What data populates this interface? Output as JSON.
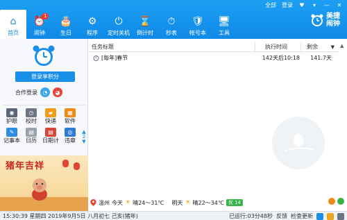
{
  "top_links": {
    "all": "全部",
    "login": "登录",
    "heart": "♥",
    "menu": "▾",
    "minimize": "—",
    "close": "✕"
  },
  "nav": [
    {
      "label": "首页",
      "icon": "home-icon",
      "glyph": "⌂"
    },
    {
      "label": "闹钟",
      "icon": "alarm-clock-icon",
      "glyph": "⏰",
      "badge": "1"
    },
    {
      "label": "生日",
      "icon": "birthday-cake-icon",
      "glyph": "🎂"
    },
    {
      "label": "程序",
      "icon": "gear-icon",
      "glyph": "⚙"
    },
    {
      "label": "定时关机",
      "icon": "power-icon",
      "glyph": "⏻"
    },
    {
      "label": "倒计时",
      "icon": "hourglass-icon",
      "glyph": "⌛"
    },
    {
      "label": "秒表",
      "icon": "stopwatch-icon",
      "glyph": "⏱"
    },
    {
      "label": "帐号本",
      "icon": "shield-icon",
      "glyph": "🛡"
    },
    {
      "label": "工具",
      "icon": "monitor-icon",
      "glyph": "🖥"
    }
  ],
  "brand": {
    "name": "美捷闹钟"
  },
  "sidebar": {
    "login_button": "登录享积分",
    "coop_label": "合作登录",
    "tools": [
      {
        "label": "护眼",
        "icon": "eye-icon",
        "color": "#5a6675",
        "glyph": "◉"
      },
      {
        "label": "校时",
        "icon": "clock-icon",
        "color": "#6b7480",
        "glyph": "◷"
      },
      {
        "label": "快递",
        "icon": "delivery-truck-icon",
        "color": "#f29b1d",
        "glyph": "▰"
      },
      {
        "label": "软件",
        "icon": "software-icon",
        "color": "#f08a17",
        "glyph": "▦"
      },
      {
        "label": "记事本",
        "icon": "notepad-icon",
        "color": "#2d8de3",
        "glyph": "✎"
      },
      {
        "label": "日历",
        "icon": "calendar-icon",
        "color": "#9aa3ad",
        "glyph": "▤"
      },
      {
        "label": "日期计",
        "icon": "date-calculator-icon",
        "color": "#d9443a",
        "glyph": "▤"
      },
      {
        "label": "违章",
        "icon": "traffic-violation-icon",
        "color": "#2f7bd6",
        "glyph": "◎"
      }
    ],
    "pager": {
      "up": "▲",
      "page": "2",
      "down": "▼"
    },
    "banner_title": "猪年吉祥"
  },
  "tasks": {
    "columns": {
      "title": "任务标题",
      "time": "执行时间",
      "remain": "剩余"
    },
    "sort": "▼",
    "scroll_up": "▲",
    "rows": [
      {
        "title": "[每年]春节",
        "time": "142天后10:18",
        "remain": "141.7天"
      }
    ]
  },
  "weather": {
    "city": "温州",
    "today_label": "今天",
    "today": "晴24～31℃",
    "tomorrow_label": "明天",
    "tomorrow": "晴22～34℃",
    "aqi": "优 14"
  },
  "status": {
    "datetime": "15:30:39 星期四 2019年9月5日 八月初七 己亥(猪年)",
    "uptime": "已运行:03分48秒",
    "feedback": "反馈",
    "update": "检查更新"
  },
  "colors": {
    "primary": "#1a8fe8",
    "alert": "#ef3b2d"
  }
}
